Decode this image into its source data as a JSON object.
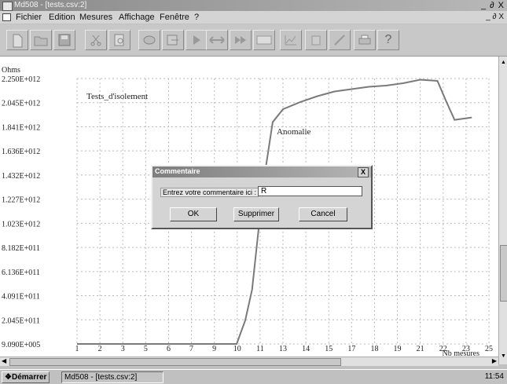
{
  "window": {
    "title": "Md508 - [tests.csv:2]",
    "controls": "_ ∂ X",
    "mdi_controls": "_ ∂ X"
  },
  "menu": [
    "Fichier",
    "Edition",
    "Mesures",
    "Affichage",
    "Fenêtre",
    "?"
  ],
  "toolbar": {
    "icons": [
      "new-file-icon",
      "open-folder-icon",
      "save-icon",
      "cut-icon",
      "preview-icon",
      "database-icon",
      "export-icon",
      "play-icon",
      "arrows-icon",
      "record-icon",
      "display-icon",
      "chart-icon",
      "battery-icon",
      "line-icon",
      "print-icon",
      "help-icon"
    ]
  },
  "chart_data": {
    "type": "line",
    "ylabel": "Ohms",
    "xlabel": "Nb mesures",
    "y_ticks": [
      "2.250E+012",
      "2.045E+012",
      "1.841E+012",
      "1.636E+012",
      "1.432E+012",
      "1.227E+012",
      "1.023E+012",
      "8.182E+011",
      "6.136E+011",
      "4.091E+011",
      "2.045E+011",
      "9.090E+005"
    ],
    "x_ticks": [
      "1",
      "2",
      "3",
      "5",
      "6",
      "7",
      "9",
      "10",
      "11",
      "13",
      "14",
      "15",
      "17",
      "18",
      "19",
      "21",
      "22",
      "23",
      "25"
    ],
    "annotations": [
      "Tests_d'isolement",
      "Anomalie"
    ],
    "series": [
      {
        "values": [
          [
            1,
            909000
          ],
          [
            2,
            909000
          ],
          [
            3,
            909000
          ],
          [
            4,
            909000
          ],
          [
            5,
            909000
          ],
          [
            6,
            909000
          ],
          [
            7,
            909000
          ],
          [
            8,
            909000
          ],
          [
            9,
            909000
          ],
          [
            10.3,
            909000
          ],
          [
            10.8,
            200000000000
          ],
          [
            11.2,
            460000000000
          ],
          [
            11.6,
            1000000000000
          ],
          [
            12.0,
            1500000000000
          ],
          [
            12.4,
            1880000000000
          ],
          [
            13.0,
            1990000000000
          ],
          [
            14.0,
            2050000000000
          ],
          [
            15.0,
            2100000000000
          ],
          [
            16.0,
            2140000000000
          ],
          [
            17.0,
            2160000000000
          ],
          [
            18.0,
            2180000000000
          ],
          [
            19.0,
            2190000000000
          ],
          [
            20.0,
            2210000000000
          ],
          [
            21.0,
            2240000000000
          ],
          [
            22.0,
            2230000000000
          ],
          [
            22.5,
            2060000000000
          ],
          [
            23.0,
            1900000000000
          ],
          [
            24.0,
            1920000000000
          ]
        ]
      }
    ],
    "color": "#7a7a7a",
    "grid": true
  },
  "dialog": {
    "title": "Commentaire",
    "close": "X",
    "prompt": "Entrez votre commentaire ici :",
    "value": "R",
    "ok": "OK",
    "delete": "Supprimer",
    "cancel": "Cancel"
  },
  "taskbar": {
    "start": "Démarrer",
    "task": "Md508 - [tests.csv:2]",
    "clock": "11:54"
  }
}
